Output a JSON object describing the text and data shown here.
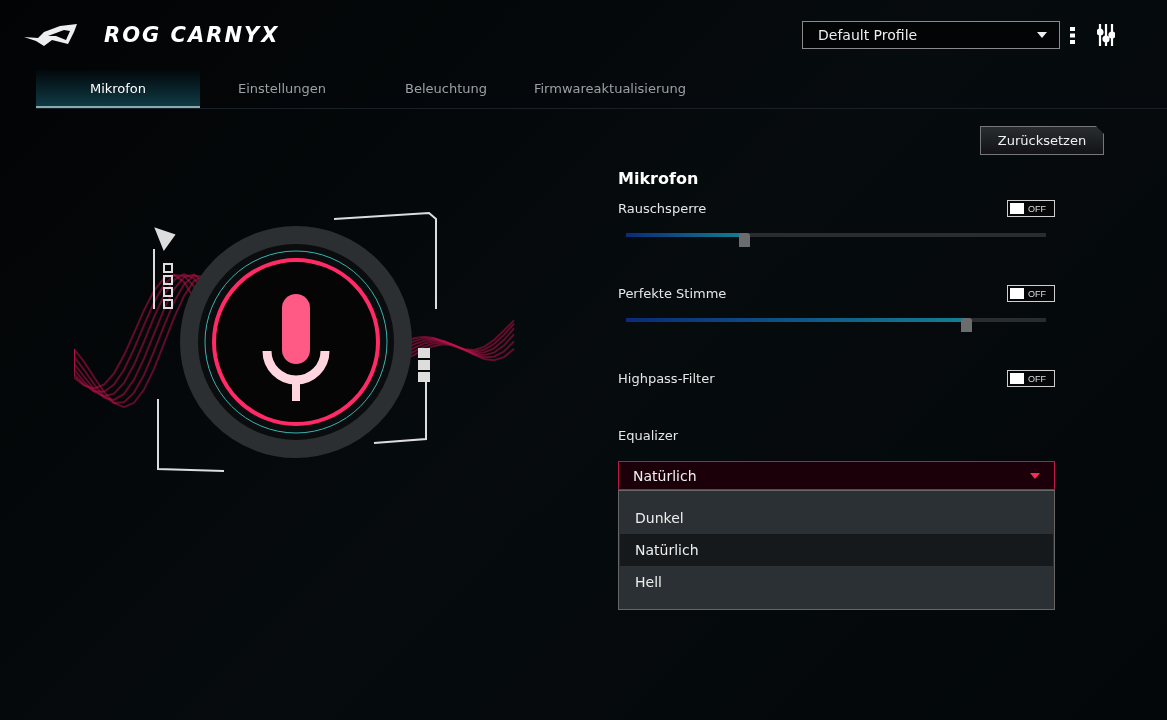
{
  "app": {
    "title": "ROG CARNYX"
  },
  "profile": {
    "value": "Default Profile"
  },
  "tabs": [
    {
      "label": "Mikrofon",
      "selected": true
    },
    {
      "label": "Einstellungen",
      "selected": false
    },
    {
      "label": "Beleuchtung",
      "selected": false
    },
    {
      "label": "Firmwareaktualisierung",
      "selected": false
    }
  ],
  "reset_button": "Zurücksetzen",
  "section_title": "Mikrofon",
  "settings": [
    {
      "kind": "slider",
      "label": "Rauschsperre",
      "on": false,
      "toggle_text": "OFF",
      "level": 0.28
    },
    {
      "kind": "slider",
      "label": "Perfekte Stimme",
      "on": false,
      "toggle_text": "OFF",
      "level": 0.81
    },
    {
      "kind": "toggle",
      "label": "Highpass-Filter",
      "on": false,
      "toggle_text": "OFF"
    }
  ],
  "equalizer": {
    "label": "Equalizer",
    "value": "Natürlich",
    "expanded": true,
    "options": [
      {
        "label": "Dunkel",
        "selected": false
      },
      {
        "label": "Natürlich",
        "selected": true
      },
      {
        "label": "Hell",
        "selected": false
      }
    ]
  }
}
